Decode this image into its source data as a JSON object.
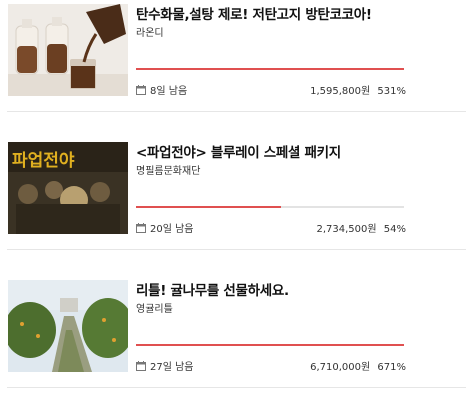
{
  "colors": {
    "progress": "#e05050",
    "track": "#e3e3e3",
    "divider": "#e6e6e6"
  },
  "projects": [
    {
      "title": "탄수화물,설탕 제로! 저탄고지 방탄코코아!",
      "maker": "라온디",
      "days_left": "8일 남음",
      "amount": "1,595,800원",
      "percent": "531%",
      "progress_fraction": 1.0,
      "thumbnail_icon": "cocoa-photo"
    },
    {
      "title": "<파업전야> 블루레이 스페셜 패키지",
      "maker": "명필름문화재단",
      "days_left": "20일 남음",
      "amount": "2,734,500원",
      "percent": "54%",
      "progress_fraction": 0.54,
      "thumbnail_icon": "movie-poster-photo",
      "thumbnail_text": "파업전야"
    },
    {
      "title": "리틀! 귤나무를 선물하세요.",
      "maker": "영귤리틀",
      "days_left": "27일 남음",
      "amount": "6,710,000원",
      "percent": "671%",
      "progress_fraction": 1.0,
      "thumbnail_icon": "orchard-photo"
    }
  ]
}
